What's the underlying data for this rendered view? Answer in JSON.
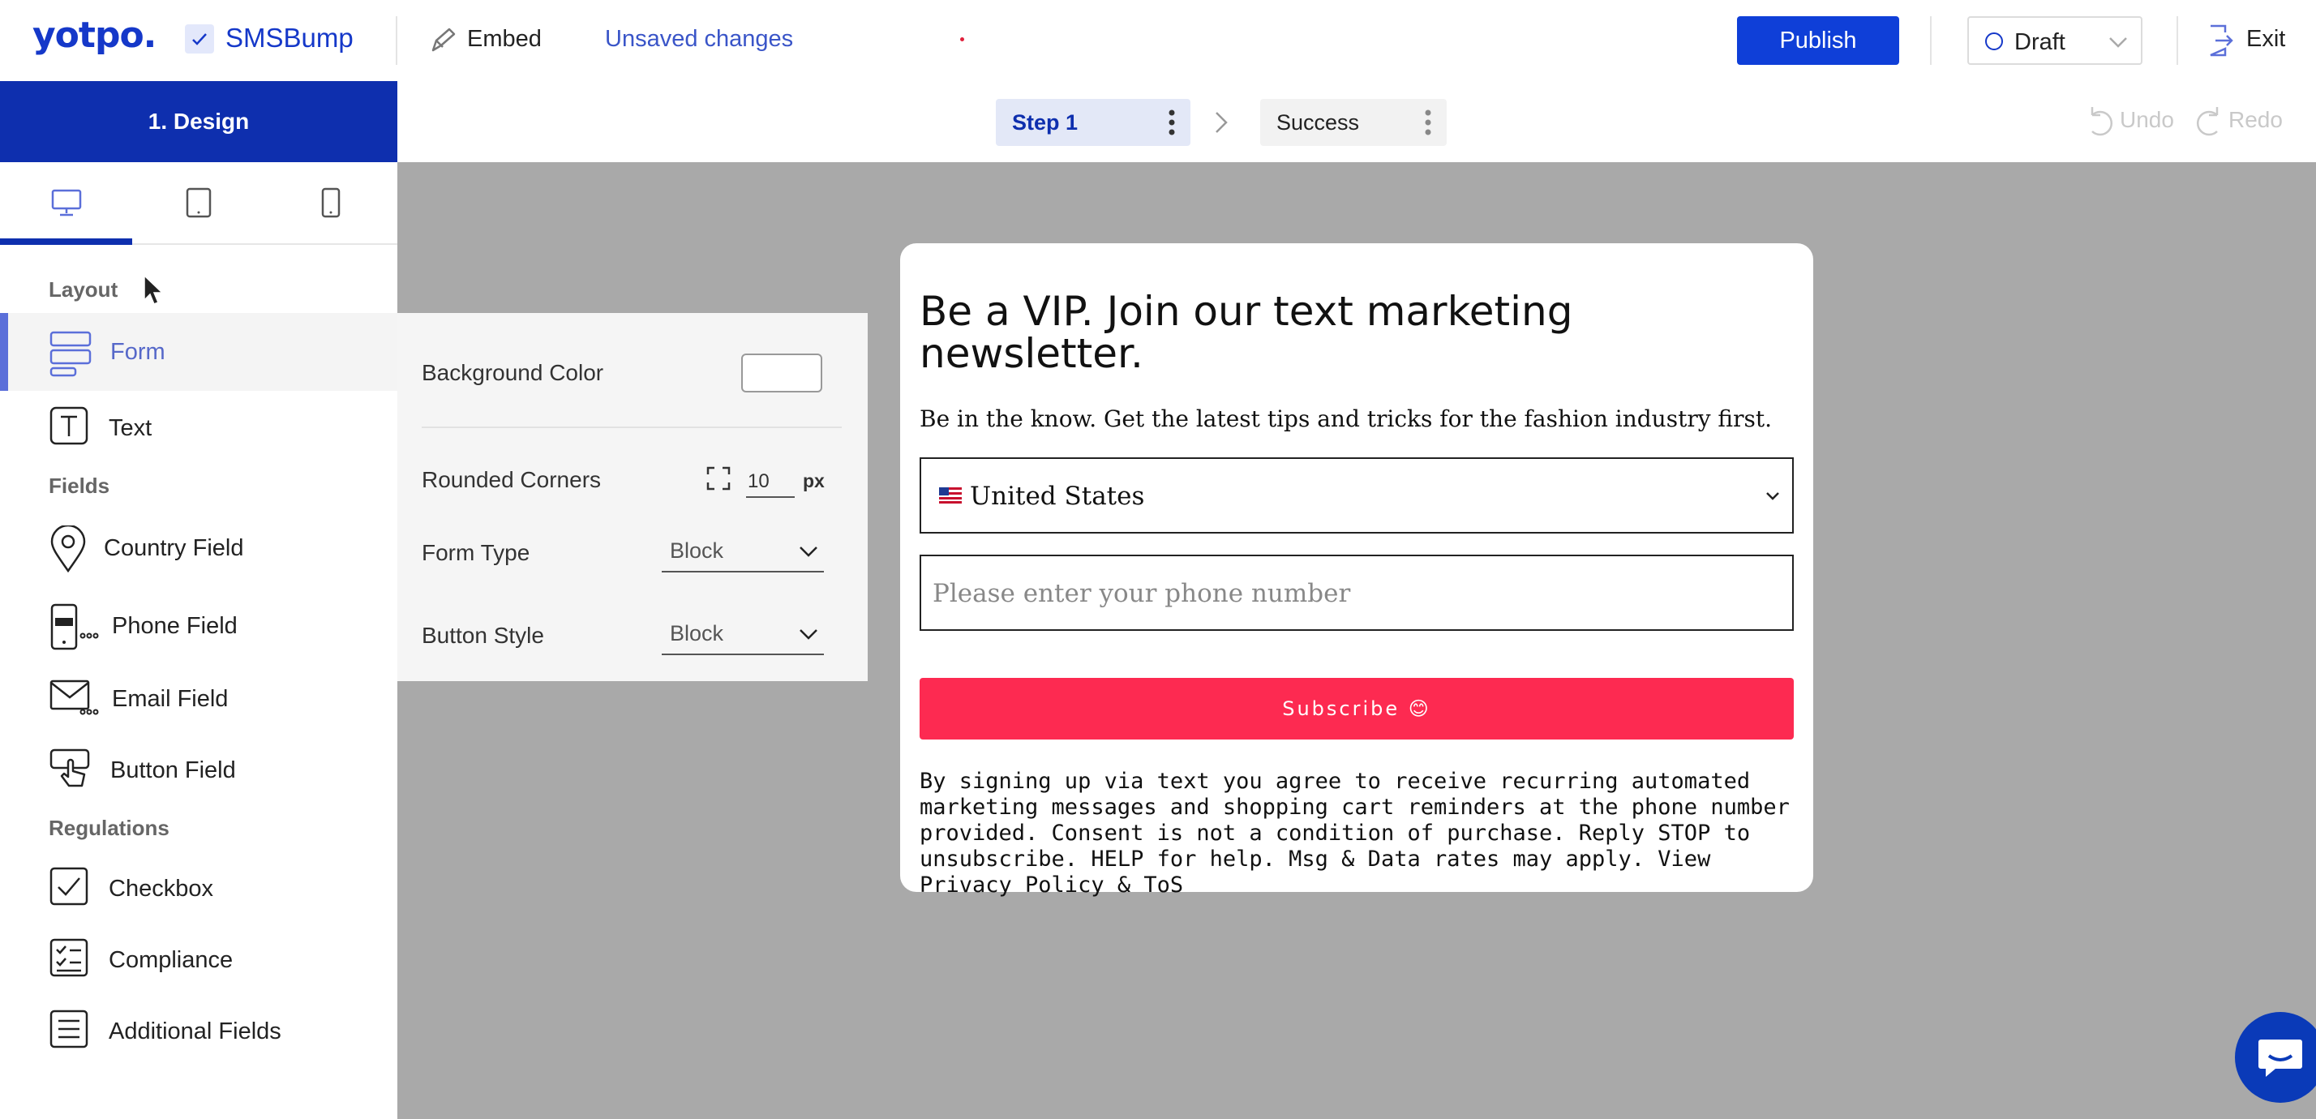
{
  "topbar": {
    "logo": "yotpo.",
    "product": "SMSBump",
    "embed_label": "Embed",
    "status": "Unsaved changes",
    "publish_label": "Publish",
    "draft_label": "Draft",
    "exit_label": "Exit"
  },
  "sidebar": {
    "tab_label": "1. Design",
    "devices": [
      "desktop-icon",
      "tablet-icon",
      "mobile-icon"
    ],
    "sections": {
      "layout": "Layout",
      "fields": "Fields",
      "regulations": "Regulations"
    },
    "items": {
      "form": "Form",
      "text": "Text",
      "country": "Country Field",
      "phone": "Phone Field",
      "email": "Email Field",
      "button": "Button Field",
      "checkbox": "Checkbox",
      "compliance": "Compliance",
      "additional": "Additional Fields"
    }
  },
  "steps": {
    "step1": "Step 1",
    "step2": "Success",
    "undo": "Undo",
    "redo": "Redo"
  },
  "props": {
    "background_color_label": "Background Color",
    "background_color_value": "#ffffff",
    "rounded_corners_label": "Rounded Corners",
    "rounded_corners_value": "10",
    "rounded_corners_unit": "px",
    "form_type_label": "Form Type",
    "form_type_value": "Block",
    "button_style_label": "Button Style",
    "button_style_value": "Block"
  },
  "popup": {
    "title": "Be a VIP. Join our text marketing newsletter.",
    "subtitle": "Be in the know. Get the latest tips and tricks for the fashion industry first.",
    "country_value": "United States",
    "phone_placeholder": "Please enter your phone number",
    "subscribe_label": "Subscribe 😊",
    "legal": "By signing up via text you agree to receive recurring automated marketing messages and shopping cart reminders at the phone number provided. Consent is not a condition of purchase. Reply STOP to unsubscribe. HELP for help. Msg & Data rates may apply. View Privacy Policy & ToS"
  },
  "colors": {
    "brand_blue": "#1538c9",
    "design_tab": "#0e2fae",
    "publish": "#0f3fd8",
    "subscribe": "#fd2a51",
    "canvas": "#a9a9a9"
  }
}
